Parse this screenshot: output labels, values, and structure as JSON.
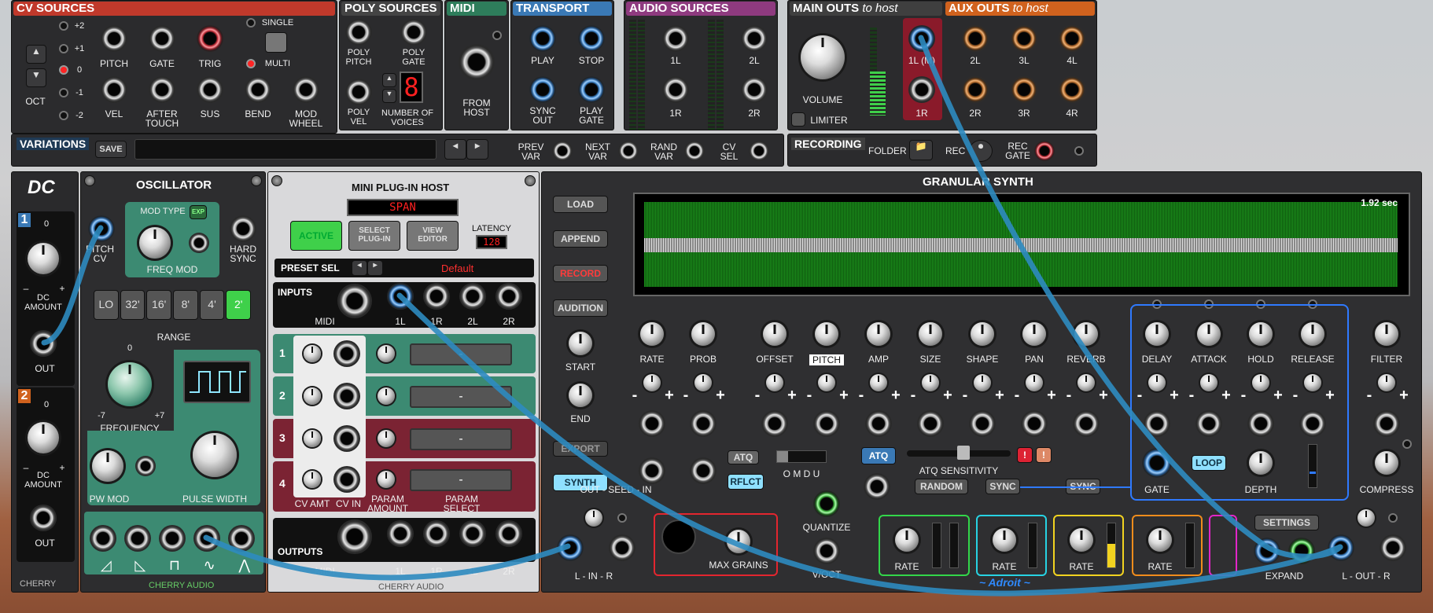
{
  "top": {
    "cv_sources": {
      "title": "CV SOURCES",
      "oct_label": "OCT",
      "oct_values": [
        "+2",
        "+1",
        "0",
        "-1",
        "-2"
      ],
      "jacks_row1": [
        "PITCH",
        "GATE",
        "TRIG"
      ],
      "jacks_row2": [
        "VEL",
        "AFTER TOUCH",
        "SUS",
        "BEND",
        "MOD WHEEL"
      ],
      "single": "SINGLE",
      "multi": "MULTI"
    },
    "poly_sources": {
      "title": "POLY SOURCES",
      "poly_pitch": "POLY PITCH",
      "poly_gate": "POLY GATE",
      "poly_vel": "POLY VEL",
      "num_voices_label": "NUMBER OF VOICES",
      "num_voices": "8"
    },
    "midi": {
      "title": "MIDI",
      "from_host": "FROM HOST"
    },
    "transport": {
      "title": "TRANSPORT",
      "play": "PLAY",
      "stop": "STOP",
      "sync_out": "SYNC OUT",
      "play_gate": "PLAY GATE"
    },
    "audio_sources": {
      "title": "AUDIO SOURCES",
      "labels": [
        "1L",
        "2L",
        "1R",
        "2R"
      ]
    },
    "main_outs": {
      "title": "MAIN OUTS",
      "title_sub": "to host",
      "volume": "VOLUME",
      "limiter": "LIMITER",
      "out_1l": "1L (M)",
      "out_1r": "1R"
    },
    "aux_outs": {
      "title": "AUX OUTS",
      "title_sub": "to host",
      "row1": [
        "2L",
        "3L",
        "4L"
      ],
      "row2": [
        "2R",
        "3R",
        "4R"
      ]
    },
    "variations": {
      "title": "VARIATIONS",
      "save": "SAVE",
      "prev": "PREV VAR",
      "next": "NEXT VAR",
      "rand": "RAND VAR",
      "cvsel": "CV SEL"
    },
    "recording": {
      "title": "RECORDING",
      "folder": "FOLDER",
      "rec": "REC",
      "rec_gate": "REC GATE"
    }
  },
  "dc": {
    "logo": "DC",
    "ch1": "1",
    "ch2": "2",
    "zero": "0",
    "minus": "–",
    "plus": "+",
    "amount": "DC AMOUNT",
    "out": "OUT",
    "brand": "CHERRY"
  },
  "osc": {
    "title": "OSCILLATOR",
    "mod_type": "MOD TYPE",
    "exp": "EXP",
    "pitch_cv": "PITCH CV",
    "hard_sync": "HARD SYNC",
    "freq_mod": "FREQ MOD",
    "ranges": [
      "LO",
      "32'",
      "16'",
      "8'",
      "4'",
      "2'"
    ],
    "range": "RANGE",
    "frequency": "FREQUENCY",
    "f_min": "-7",
    "f_max": "+7",
    "f_zero": "0",
    "pw_mod": "PW MOD",
    "pulse_width": "PULSE WIDTH",
    "brand": "CHERRY AUDIO"
  },
  "host": {
    "title": "MINI PLUG-IN HOST",
    "plugin_name": "SPAN",
    "active": "ACTIVE",
    "select": "SELECT PLUG-IN",
    "view": "VIEW EDITOR",
    "latency": "LATENCY",
    "latency_val": "128",
    "preset_sel": "PRESET SEL",
    "preset": "Default",
    "inputs": "INPUTS",
    "midi": "MIDI",
    "ch": [
      "1L",
      "1R",
      "2L",
      "2R"
    ],
    "rows": [
      "1",
      "2",
      "3",
      "4"
    ],
    "slot_text": "-",
    "cv_amt": "CV AMT",
    "cv_in": "CV IN",
    "param_amount": "PARAM AMOUNT",
    "param_select": "PARAM SELECT",
    "outputs": "OUTPUTS",
    "brand": "CHERRY AUDIO"
  },
  "gran": {
    "title": "GRANULAR SYNTH",
    "duration": "1.92 sec",
    "load": "LOAD",
    "append": "APPEND",
    "record": "RECORD",
    "audition": "AUDITION",
    "start": "START",
    "end": "END",
    "export": "EXPORT",
    "synth": "SYNTH",
    "params": [
      "RATE",
      "PROB",
      "OFFSET",
      "PITCH",
      "AMP",
      "SIZE",
      "SHAPE",
      "PAN",
      "REVERB"
    ],
    "env": [
      "DELAY",
      "ATTACK",
      "HOLD",
      "RELEASE"
    ],
    "filter": "FILTER",
    "compress": "COMPRESS",
    "seed": "OUT - SEED - IN",
    "atq": "ATQ",
    "rflct": "RFLCT",
    "omdu": "O M D U",
    "atq_sens": "ATQ SENSITIVITY",
    "random": "RANDOM",
    "sync": "SYNC",
    "quantize": "QUANTIZE",
    "voct": "V/OCT",
    "gate": "GATE",
    "loop": "LOOP",
    "depth": "DEPTH",
    "max_grains": "MAX GRAINS",
    "lfo_rate": "RATE",
    "settings": "SETTINGS",
    "expand": "EXPAND",
    "lin": "L - IN - R",
    "lout": "L - OUT - R",
    "brand": "~ Adroit ~",
    "minus": "-",
    "plus": "+"
  },
  "colors": {
    "cv": "#c0392b",
    "poly": "#555",
    "midi": "#2e7d5b",
    "transport": "#3a79b5",
    "audio": "#8e3a7f",
    "main": "#3f3f3f",
    "aux": "#d0621e",
    "teal": "#3c8a72",
    "maroon": "#7b2333",
    "accent": "#ff2020"
  }
}
